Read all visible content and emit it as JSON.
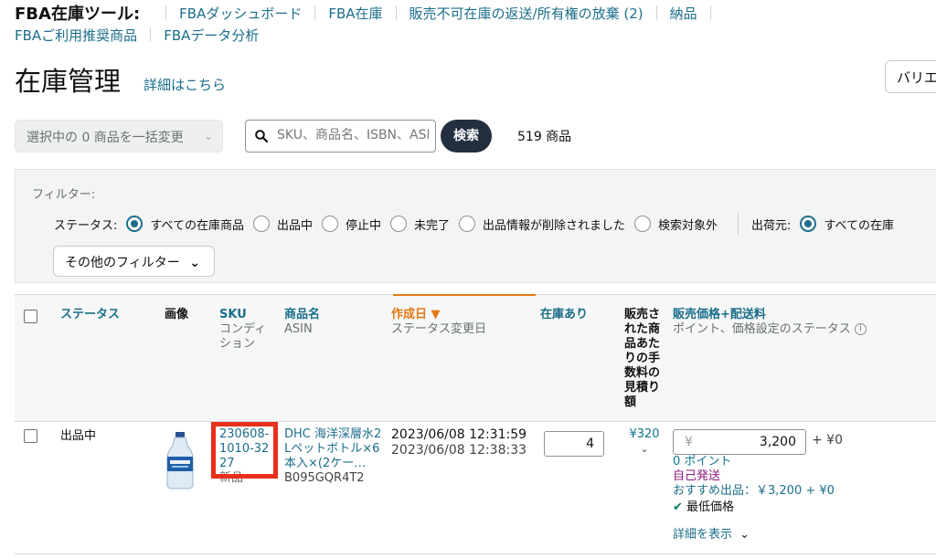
{
  "nav": {
    "brand": "FBA在庫ツール:",
    "links": [
      "FBAダッシュボード",
      "FBA在庫",
      "販売不可在庫の返送/所有権の放棄 (2)",
      "納品"
    ],
    "links_row2": [
      "FBAご利用推奨商品",
      "FBAデータ分析"
    ]
  },
  "page": {
    "title": "在庫管理",
    "detail_link": "詳細はこちら",
    "variation_button": "バリエ"
  },
  "toolbar": {
    "bulk_select": "選択中の 0 商品を一括変更",
    "search_placeholder": "SKU、商品名、ISBN、ASIN",
    "search_button": "検索",
    "count": "519 商品"
  },
  "filters": {
    "label": "フィルター:",
    "status_label": "ステータス:",
    "status_options": [
      "すべての在庫商品",
      "出品中",
      "停止中",
      "未完了",
      "出品情報が削除されました",
      "検索対象外"
    ],
    "status_selected": 0,
    "shipper_label": "出荷元:",
    "shipper_selected": "すべての在庫",
    "more_filters": "その他のフィルター"
  },
  "table": {
    "headers": {
      "status": "ステータス",
      "image": "画像",
      "sku": "SKU",
      "sku_sub": "コンディション",
      "name": "商品名",
      "name_sub": "ASIN",
      "created": "作成日",
      "created_sub": "ステータス変更日",
      "stock": "在庫あり",
      "fee": "販売された商品あたりの手数料の見積り額",
      "price": "販売価格+配送料",
      "price_sub": "ポイント、価格設定のステータス"
    },
    "rows": [
      {
        "status": "出品中",
        "sku": "230608-1010-3227",
        "condition": "新品",
        "name": "DHC 海洋深層水2Lペットボトル×6本入×(2ケー…",
        "asin": "B095GQR4T2",
        "created": "2023/06/08 12:31:59",
        "status_changed": "2023/06/08 12:38:33",
        "stock": "4",
        "fee": "¥320",
        "price_symbol": "¥",
        "price": "3,200",
        "shipping": "+ ¥0",
        "points": "0 ポイント",
        "fulfillment": "自己発送",
        "recommended": "おすすめ出品：￥3,200 + ¥0",
        "lowest_price": "最低価格",
        "show_details": "詳細を表示"
      }
    ]
  }
}
